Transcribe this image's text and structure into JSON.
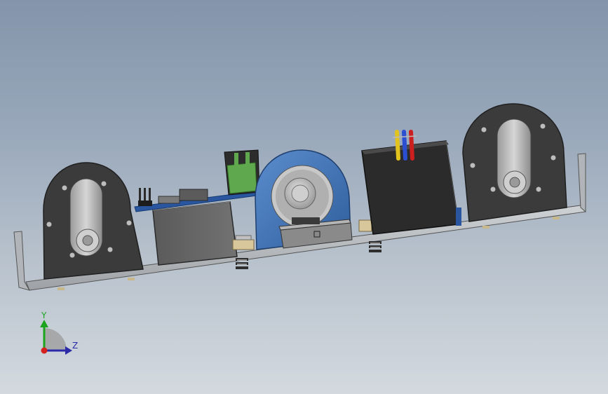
{
  "viewport": {
    "background_top": "#8395ab",
    "background_bottom": "#d3d9df"
  },
  "model": {
    "parts": [
      "base-plate",
      "left-wheel-bracket",
      "right-wheel-bracket",
      "gear-motor",
      "circuit-board",
      "terminal-block",
      "cable-guide-ring",
      "switch-box",
      "battery-box",
      "colored-wires"
    ],
    "colors": {
      "plate": "#b9bcc0",
      "bracket": "#3a3a3a",
      "pcb": "#2a56a0",
      "terminal": "#5fa84d",
      "ring": "#3f72b3",
      "wire_yellow": "#e2c21c",
      "wire_blue": "#2b4fd0",
      "wire_red": "#cc1f1f"
    }
  },
  "triad": {
    "y_label": "Y",
    "z_label": "Z",
    "y_color": "#1ea31e",
    "z_color": "#2b2ba8",
    "x_color": "#d61f1f"
  }
}
